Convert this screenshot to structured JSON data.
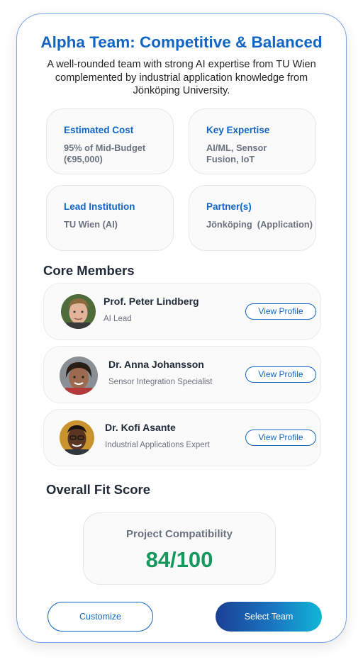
{
  "team": {
    "title": "Alpha Team: Competitive & Balanced",
    "subtitle": "A well-rounded team with strong AI expertise from TU Wien complemented by industrial application knowledge from Jönköping University."
  },
  "info": [
    {
      "label": "Estimated Cost",
      "value": "95% of Mid-Budget (€95,000)"
    },
    {
      "label": "Key Expertise",
      "value": "AI/ML, Sensor Fusion, IoT"
    },
    {
      "label": "Lead Institution",
      "value": "TU Wien (AI)"
    },
    {
      "label": "Partner(s)",
      "value": "Jönköping  (Application)"
    }
  ],
  "core_members": {
    "title": "Core Members",
    "view_label": "View Profile",
    "members": [
      {
        "name": "Prof. Peter Lindberg",
        "role": "AI Lead"
      },
      {
        "name": "Dr. Anna Johansson",
        "role": "Sensor Integration Specialist"
      },
      {
        "name": "Dr. Kofi Asante",
        "role": "Industrial Applications Expert"
      }
    ]
  },
  "fit": {
    "title": "Overall Fit Score",
    "label": "Project Compatibility",
    "score": "84/100"
  },
  "actions": {
    "customize": "Customize",
    "select": "Select Team"
  },
  "colors": {
    "accent": "#1166c5",
    "score": "#14985e"
  }
}
